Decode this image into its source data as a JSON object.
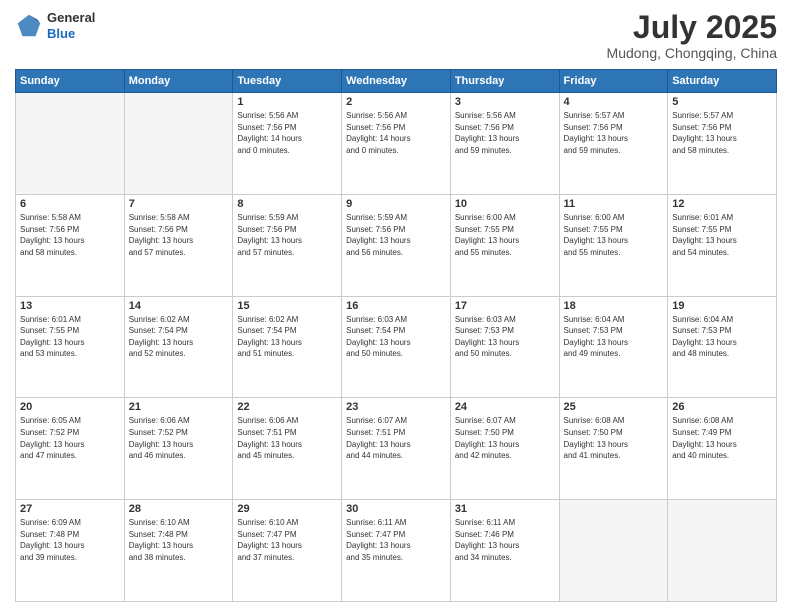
{
  "header": {
    "logo_general": "General",
    "logo_blue": "Blue",
    "month_title": "July 2025",
    "subtitle": "Mudong, Chongqing, China"
  },
  "weekdays": [
    "Sunday",
    "Monday",
    "Tuesday",
    "Wednesday",
    "Thursday",
    "Friday",
    "Saturday"
  ],
  "weeks": [
    [
      {
        "day": "",
        "text": ""
      },
      {
        "day": "",
        "text": ""
      },
      {
        "day": "1",
        "text": "Sunrise: 5:56 AM\nSunset: 7:56 PM\nDaylight: 14 hours\nand 0 minutes."
      },
      {
        "day": "2",
        "text": "Sunrise: 5:56 AM\nSunset: 7:56 PM\nDaylight: 14 hours\nand 0 minutes."
      },
      {
        "day": "3",
        "text": "Sunrise: 5:56 AM\nSunset: 7:56 PM\nDaylight: 13 hours\nand 59 minutes."
      },
      {
        "day": "4",
        "text": "Sunrise: 5:57 AM\nSunset: 7:56 PM\nDaylight: 13 hours\nand 59 minutes."
      },
      {
        "day": "5",
        "text": "Sunrise: 5:57 AM\nSunset: 7:56 PM\nDaylight: 13 hours\nand 58 minutes."
      }
    ],
    [
      {
        "day": "6",
        "text": "Sunrise: 5:58 AM\nSunset: 7:56 PM\nDaylight: 13 hours\nand 58 minutes."
      },
      {
        "day": "7",
        "text": "Sunrise: 5:58 AM\nSunset: 7:56 PM\nDaylight: 13 hours\nand 57 minutes."
      },
      {
        "day": "8",
        "text": "Sunrise: 5:59 AM\nSunset: 7:56 PM\nDaylight: 13 hours\nand 57 minutes."
      },
      {
        "day": "9",
        "text": "Sunrise: 5:59 AM\nSunset: 7:56 PM\nDaylight: 13 hours\nand 56 minutes."
      },
      {
        "day": "10",
        "text": "Sunrise: 6:00 AM\nSunset: 7:55 PM\nDaylight: 13 hours\nand 55 minutes."
      },
      {
        "day": "11",
        "text": "Sunrise: 6:00 AM\nSunset: 7:55 PM\nDaylight: 13 hours\nand 55 minutes."
      },
      {
        "day": "12",
        "text": "Sunrise: 6:01 AM\nSunset: 7:55 PM\nDaylight: 13 hours\nand 54 minutes."
      }
    ],
    [
      {
        "day": "13",
        "text": "Sunrise: 6:01 AM\nSunset: 7:55 PM\nDaylight: 13 hours\nand 53 minutes."
      },
      {
        "day": "14",
        "text": "Sunrise: 6:02 AM\nSunset: 7:54 PM\nDaylight: 13 hours\nand 52 minutes."
      },
      {
        "day": "15",
        "text": "Sunrise: 6:02 AM\nSunset: 7:54 PM\nDaylight: 13 hours\nand 51 minutes."
      },
      {
        "day": "16",
        "text": "Sunrise: 6:03 AM\nSunset: 7:54 PM\nDaylight: 13 hours\nand 50 minutes."
      },
      {
        "day": "17",
        "text": "Sunrise: 6:03 AM\nSunset: 7:53 PM\nDaylight: 13 hours\nand 50 minutes."
      },
      {
        "day": "18",
        "text": "Sunrise: 6:04 AM\nSunset: 7:53 PM\nDaylight: 13 hours\nand 49 minutes."
      },
      {
        "day": "19",
        "text": "Sunrise: 6:04 AM\nSunset: 7:53 PM\nDaylight: 13 hours\nand 48 minutes."
      }
    ],
    [
      {
        "day": "20",
        "text": "Sunrise: 6:05 AM\nSunset: 7:52 PM\nDaylight: 13 hours\nand 47 minutes."
      },
      {
        "day": "21",
        "text": "Sunrise: 6:06 AM\nSunset: 7:52 PM\nDaylight: 13 hours\nand 46 minutes."
      },
      {
        "day": "22",
        "text": "Sunrise: 6:06 AM\nSunset: 7:51 PM\nDaylight: 13 hours\nand 45 minutes."
      },
      {
        "day": "23",
        "text": "Sunrise: 6:07 AM\nSunset: 7:51 PM\nDaylight: 13 hours\nand 44 minutes."
      },
      {
        "day": "24",
        "text": "Sunrise: 6:07 AM\nSunset: 7:50 PM\nDaylight: 13 hours\nand 42 minutes."
      },
      {
        "day": "25",
        "text": "Sunrise: 6:08 AM\nSunset: 7:50 PM\nDaylight: 13 hours\nand 41 minutes."
      },
      {
        "day": "26",
        "text": "Sunrise: 6:08 AM\nSunset: 7:49 PM\nDaylight: 13 hours\nand 40 minutes."
      }
    ],
    [
      {
        "day": "27",
        "text": "Sunrise: 6:09 AM\nSunset: 7:48 PM\nDaylight: 13 hours\nand 39 minutes."
      },
      {
        "day": "28",
        "text": "Sunrise: 6:10 AM\nSunset: 7:48 PM\nDaylight: 13 hours\nand 38 minutes."
      },
      {
        "day": "29",
        "text": "Sunrise: 6:10 AM\nSunset: 7:47 PM\nDaylight: 13 hours\nand 37 minutes."
      },
      {
        "day": "30",
        "text": "Sunrise: 6:11 AM\nSunset: 7:47 PM\nDaylight: 13 hours\nand 35 minutes."
      },
      {
        "day": "31",
        "text": "Sunrise: 6:11 AM\nSunset: 7:46 PM\nDaylight: 13 hours\nand 34 minutes."
      },
      {
        "day": "",
        "text": ""
      },
      {
        "day": "",
        "text": ""
      }
    ]
  ]
}
